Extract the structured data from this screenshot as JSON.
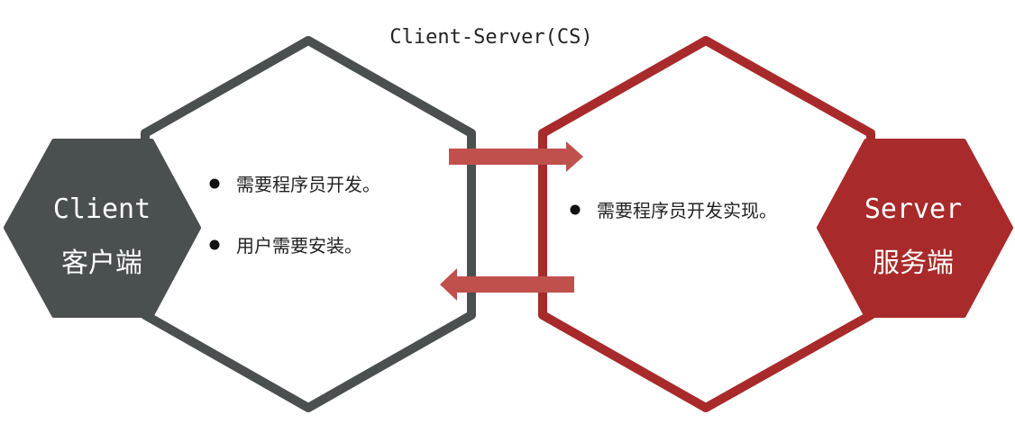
{
  "title": "Client-Server(CS)",
  "client": {
    "name_en": "Client",
    "name_cn": "客户端",
    "bullets": [
      "需要程序员开发。",
      "用户需要安装。"
    ]
  },
  "server": {
    "name_en": "Server",
    "name_cn": "服务端",
    "bullets": [
      "需要程序员开发实现。"
    ]
  },
  "colors": {
    "client": "#4a4f4f",
    "server": "#a82a2a",
    "arrow": "#c0504d"
  }
}
